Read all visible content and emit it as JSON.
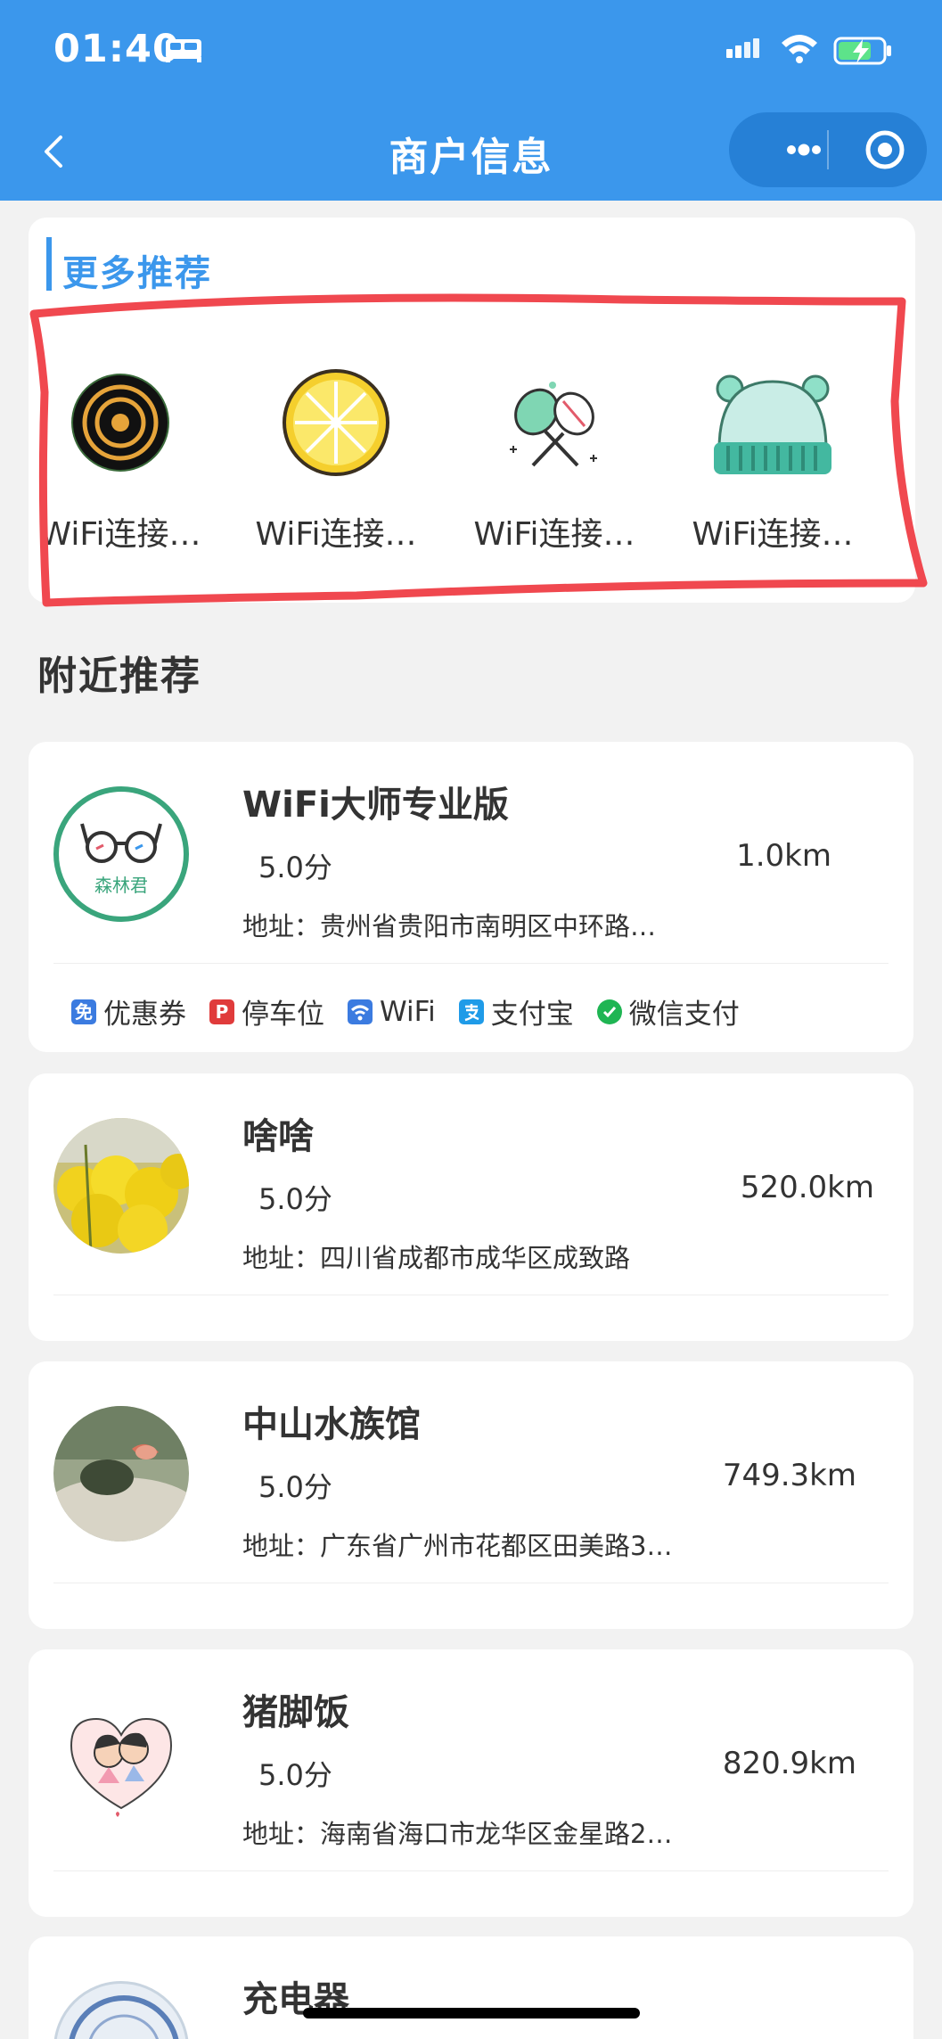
{
  "status_bar": {
    "time": "01:40"
  },
  "nav": {
    "title": "商户信息"
  },
  "more_section": {
    "title": "更多推荐",
    "items": [
      {
        "label": "WiFi连接…",
        "icon": "target-rings-icon"
      },
      {
        "label": "WiFi连接…",
        "icon": "lemon-slice-icon"
      },
      {
        "label": "WiFi连接…",
        "icon": "badminton-rackets-icon"
      },
      {
        "label": "WiFi连接…",
        "icon": "knit-hat-icon"
      }
    ]
  },
  "nearby": {
    "title": "附近推荐",
    "merchants": [
      {
        "name": "WiFi大师专业版",
        "score": "5.0分",
        "distance": "1.0km",
        "address": "地址：贵州省贵阳市南明区中环路…",
        "avatar_text": "森林君",
        "tags": [
          "优惠券",
          "停车位",
          "WiFi",
          "支付宝",
          "微信支付"
        ],
        "tag_icons": [
          "免",
          "P"
        ]
      },
      {
        "name": "啥啥",
        "score": "5.0分",
        "distance": "520.0km",
        "address": "地址：四川省成都市成华区成致路"
      },
      {
        "name": "中山水族馆",
        "score": "5.0分",
        "distance": "749.3km",
        "address": "地址：广东省广州市花都区田美路3…"
      },
      {
        "name": "猪脚饭",
        "score": "5.0分",
        "distance": "820.9km",
        "address": "地址：海南省海口市龙华区金星路2…"
      },
      {
        "name": "充电器"
      }
    ]
  },
  "colors": {
    "primary": "#3b97ec",
    "highlight": "#f0484f"
  }
}
